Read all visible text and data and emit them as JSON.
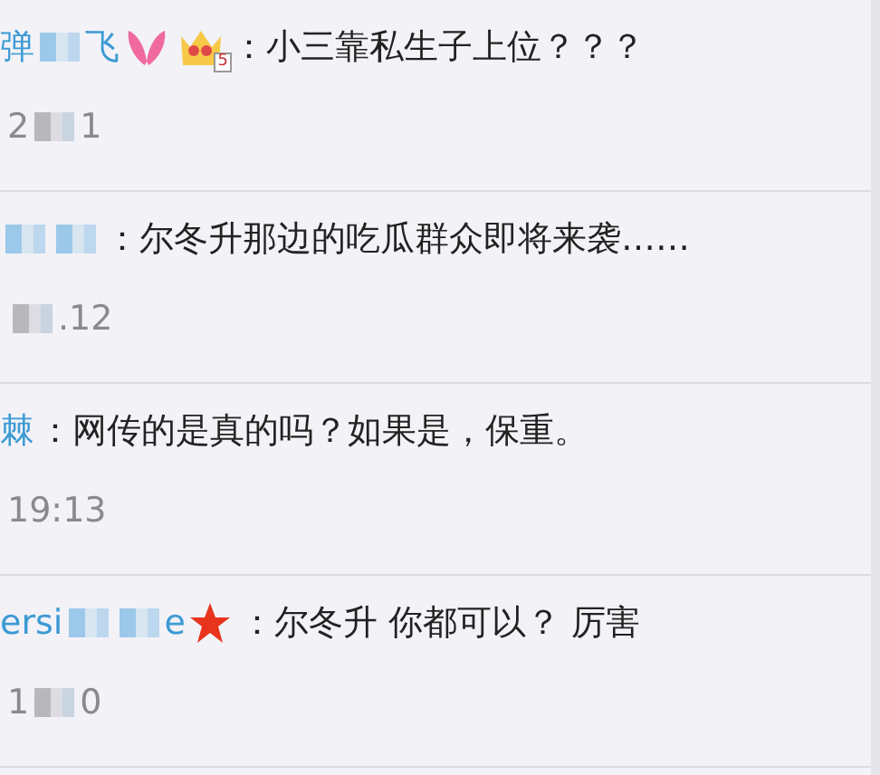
{
  "comments": [
    {
      "user": [
        {
          "kind": "text",
          "text": "弹"
        },
        {
          "kind": "blur"
        },
        {
          "kind": "text",
          "text": "飞"
        }
      ],
      "badges": [
        {
          "kind": "bunny"
        },
        {
          "kind": "crown",
          "label": "5"
        }
      ],
      "text": "：小三靠私生子上位？？？",
      "time": [
        {
          "kind": "text",
          "text": "2"
        },
        {
          "kind": "blur"
        },
        {
          "kind": "text",
          "text": "1"
        }
      ]
    },
    {
      "user": [
        {
          "kind": "blur"
        },
        {
          "kind": "blur"
        }
      ],
      "text": "：尔冬升那边的吃瓜群众即将来袭……",
      "time": [
        {
          "kind": "blur"
        },
        {
          "kind": "text",
          "text": ".12"
        }
      ]
    },
    {
      "user": [
        {
          "kind": "text",
          "text": "棘"
        }
      ],
      "text": "：网传的是真的吗？如果是，保重。",
      "time": [
        {
          "kind": "text",
          "text": "19:13"
        }
      ]
    },
    {
      "user": [
        {
          "kind": "text",
          "text": "ersi"
        },
        {
          "kind": "blur"
        },
        {
          "kind": "blur"
        },
        {
          "kind": "text",
          "text": "e"
        }
      ],
      "badges": [
        {
          "kind": "star"
        }
      ],
      "text": "：尔冬升  你都可以？ 厉害",
      "time": [
        {
          "kind": "text",
          "text": "1"
        },
        {
          "kind": "blur"
        },
        {
          "kind": "text",
          "text": "0"
        }
      ]
    }
  ]
}
